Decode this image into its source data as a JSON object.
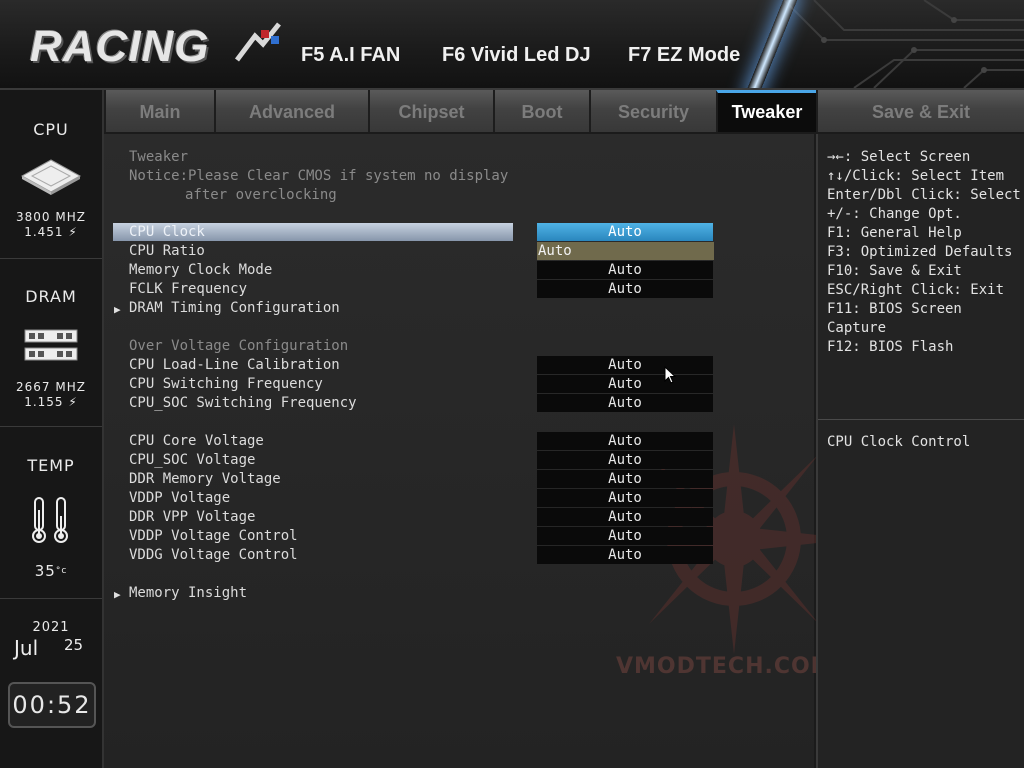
{
  "header": {
    "logo_text": "RACING",
    "f5_label": "F5 A.I FAN",
    "f6_label": "F6 Vivid Led DJ",
    "f7_label": "F7 EZ Mode"
  },
  "sidebar": {
    "cpu": {
      "title": "CPU",
      "freq": "3800 MHZ",
      "voltage": "1.451"
    },
    "dram": {
      "title": "DRAM",
      "freq": "2667 MHZ",
      "voltage": "1.155"
    },
    "temp": {
      "title": "TEMP",
      "value": "35"
    },
    "date": {
      "year": "2021",
      "month": "Jul",
      "day": "25"
    },
    "time": "00:52"
  },
  "tabs": [
    {
      "label": "Main"
    },
    {
      "label": "Advanced"
    },
    {
      "label": "Chipset"
    },
    {
      "label": "Boot"
    },
    {
      "label": "Security"
    },
    {
      "label": "Tweaker"
    },
    {
      "label": "Save & Exit"
    }
  ],
  "active_tab": "Tweaker",
  "main": {
    "section_title": "Tweaker",
    "notice_line1": "Notice:Please Clear CMOS if system no display",
    "notice_line2": "after overclocking",
    "items": [
      {
        "label": "CPU Clock",
        "value": "Auto"
      },
      {
        "label": "CPU Ratio",
        "value": "Auto"
      },
      {
        "label": "Memory Clock Mode",
        "value": "Auto"
      },
      {
        "label": "FCLK Frequency",
        "value": "Auto"
      },
      {
        "label": "DRAM Timing Configuration"
      },
      {
        "label": "Over Voltage Configuration"
      },
      {
        "label": "CPU Load-Line Calibration",
        "value": "Auto"
      },
      {
        "label": "CPU Switching Frequency",
        "value": "Auto"
      },
      {
        "label": "CPU_SOC Switching Frequency",
        "value": "Auto"
      },
      {
        "label": "CPU Core Voltage",
        "value": "Auto"
      },
      {
        "label": "CPU_SOC Voltage",
        "value": "Auto"
      },
      {
        "label": "DDR Memory Voltage",
        "value": "Auto"
      },
      {
        "label": "VDDP Voltage",
        "value": "Auto"
      },
      {
        "label": "DDR VPP Voltage",
        "value": "Auto"
      },
      {
        "label": "VDDP Voltage Control",
        "value": "Auto"
      },
      {
        "label": "VDDG Voltage Control",
        "value": "Auto"
      },
      {
        "label": "Memory Insight"
      }
    ]
  },
  "help": {
    "keys": [
      "→←: Select Screen",
      "↑↓/Click: Select Item",
      "Enter/Dbl Click: Select",
      "+/-: Change Opt.",
      "F1: General Help",
      "F3: Optimized Defaults",
      "F10: Save & Exit",
      "ESC/Right Click: Exit",
      "F11: BIOS Screen",
      "Capture",
      "F12: BIOS Flash"
    ],
    "description": "CPU Clock Control"
  },
  "watermark": "VMODTECH.COM",
  "colors": {
    "accent_blue": "#3fa3d8",
    "selected_value_bg": "#706a4c",
    "value_bg": "#0a0a0a"
  }
}
